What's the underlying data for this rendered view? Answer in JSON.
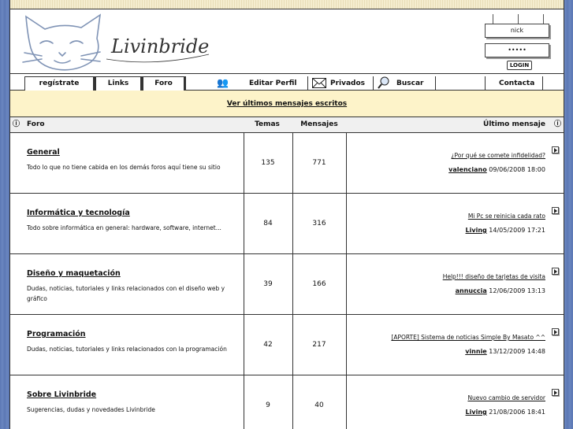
{
  "site": {
    "name": "Livinbride"
  },
  "login": {
    "username": "nick",
    "password": "•••••",
    "button": "LOGIN"
  },
  "nav": {
    "tabs": [
      "regístrate",
      "Links",
      "Foro"
    ],
    "items": [
      "Editar Perfil",
      "Privados",
      "Buscar",
      "Contacta"
    ]
  },
  "banner": {
    "link": "Ver últimos mensajes escritos"
  },
  "table": {
    "headers": {
      "foro": "Foro",
      "temas": "Temas",
      "mensajes": "Mensajes",
      "ultimo": "Último mensaje"
    },
    "rows": [
      {
        "name": "General",
        "desc": "Todo lo que no tiene cabida en los demás foros aquí tiene su sitio",
        "temas": "135",
        "mensajes": "771",
        "last_title": "¿Por qué se comete infidelidad?",
        "last_user": "valenciano",
        "last_date": "09/06/2008 18:00"
      },
      {
        "name": "Informática y tecnología",
        "desc": "Todo sobre informática en general: hardware, software, internet...",
        "temas": "84",
        "mensajes": "316",
        "last_title": "Mi Pc se reinicia cada rato",
        "last_user": "Living",
        "last_date": "14/05/2009 17:21"
      },
      {
        "name": "Diseño y maquetación",
        "desc": "Dudas, noticias, tutoriales y links relacionados con el diseño web y gráfico",
        "temas": "39",
        "mensajes": "166",
        "last_title": "Help!!! diseño de tarjetas de visita",
        "last_user": "annuccia",
        "last_date": "12/06/2009 13:13"
      },
      {
        "name": "Programación",
        "desc": "Dudas, noticias, tutoriales y links relacionados con la programación",
        "temas": "42",
        "mensajes": "217",
        "last_title": "[APORTE] Sistema de noticias Simple By Masato ^^",
        "last_user": "vinnie",
        "last_date": "13/12/2009 14:48"
      },
      {
        "name": "Sobre Livinbride",
        "desc": "Sugerencias, dudas y novedades Livinbride",
        "temas": "9",
        "mensajes": "40",
        "last_title": "Nuevo cambio de servidor",
        "last_user": "Living",
        "last_date": "21/08/2006 18:41"
      }
    ]
  }
}
